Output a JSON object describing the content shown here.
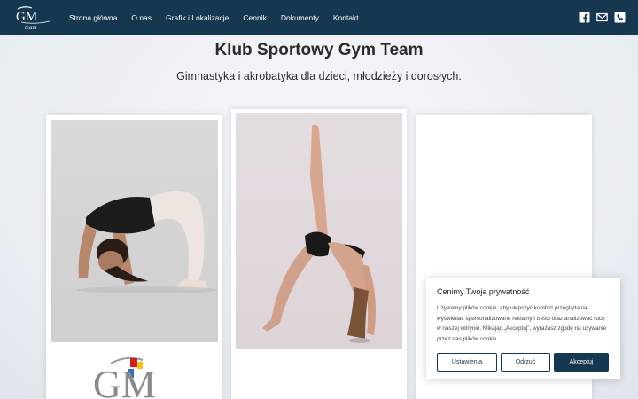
{
  "brand": {
    "logo_text": "GM",
    "logo_sub": "team",
    "color": "#163750"
  },
  "nav": {
    "items": [
      "Strona główna",
      "O nas",
      "Grafik i Lokalizacje",
      "Cennik",
      "Dokumenty",
      "Kontakt"
    ]
  },
  "social": {
    "icons": [
      "facebook-icon",
      "mail-icon",
      "phone-icon"
    ]
  },
  "hero": {
    "title": "Klub Sportowy Gym Team",
    "subtitle": "Gimnastyka i akrobatyka dla dzieci, młodzieży i dorosłych."
  },
  "cards": {
    "club_logo_text": "GM"
  },
  "cookie": {
    "title": "Cenimy Twoją prywatność",
    "text": "Używamy plików cookie, aby ulepszyć komfort przeglądania, wyświetlać spersonalizowane reklamy i treści oraz analizować ruch w naszej witrynie. Klikając „Akceptuj”, wyrażasz zgodę na używanie przez nas plików cookie.",
    "settings_label": "Ustawienia",
    "reject_label": "Odrzuć",
    "accept_label": "Akceptuj"
  }
}
